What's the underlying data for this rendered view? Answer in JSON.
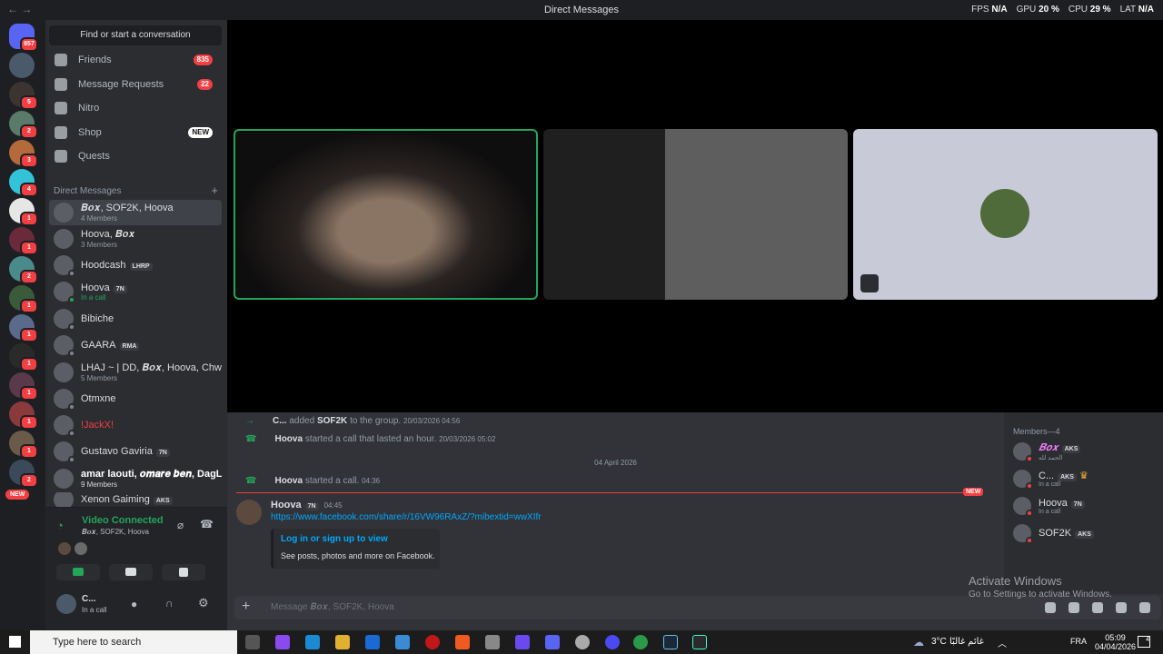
{
  "window": {
    "title": "Direct Messages",
    "nav": "←  →"
  },
  "overlay": {
    "fps_label": "FPS",
    "fps": "N/A",
    "gpu_label": "GPU",
    "gpu": "20 %",
    "cpu_label": "CPU",
    "cpu": "29 %",
    "lat_label": "LAT",
    "lat": "N/A"
  },
  "guilds": {
    "home_badge": "857",
    "new_label": "NEW",
    "badges": [
      "5",
      "2",
      "3",
      "4",
      "1",
      "1",
      "2",
      "1",
      "1",
      "1",
      "1",
      "1",
      "1",
      "2",
      "1"
    ]
  },
  "sidebar": {
    "find": "Find or start a conversation",
    "nav": [
      {
        "label": "Friends",
        "badge": "835"
      },
      {
        "label": "Message Requests",
        "badge": "22"
      },
      {
        "label": "Nitro",
        "badge": ""
      },
      {
        "label": "Shop",
        "badge": "NEW"
      },
      {
        "label": "Quests",
        "badge": ""
      }
    ],
    "dm_header": "Direct Messages",
    "dms": [
      {
        "name": "𝑩𝒐𝒙, SOF2K, Hoova",
        "sub": "4 Members",
        "tag": ""
      },
      {
        "name": "Hoova, 𝑩𝒐𝒙",
        "sub": "3 Members",
        "tag": ""
      },
      {
        "name": "Hoodcash",
        "sub": "",
        "tag": "LHRP"
      },
      {
        "name": "Hoova",
        "sub": "In a call",
        "tag": "7N"
      },
      {
        "name": "Bibiche",
        "sub": "",
        "tag": ""
      },
      {
        "name": "GAARA",
        "sub": "",
        "tag": "RMA"
      },
      {
        "name": "LHAJ ~ | DD, 𝑩𝒐𝒙, Hoova, Chwi...",
        "sub": "5 Members",
        "tag": ""
      },
      {
        "name": "Otmxne",
        "sub": "",
        "tag": ""
      },
      {
        "name": "!JackX!",
        "sub": "",
        "tag": ""
      },
      {
        "name": "Gustavo Gaviria",
        "sub": "",
        "tag": "7N"
      },
      {
        "name": "amar laouti, 𝒐𝒎𝒂𝒓𝒆 𝒃𝒆𝒏, DagLa,...",
        "sub": "9 Members",
        "tag": ""
      },
      {
        "name": "Xenon Gaiming",
        "sub": "",
        "tag": "AKS"
      }
    ]
  },
  "voice": {
    "status": "Video Connected",
    "channel": "𝑩𝒐𝒙, SOF2K, Hoova"
  },
  "user": {
    "name": "C...",
    "status": "In a call"
  },
  "chat": {
    "system": [
      {
        "actor": "C...",
        "text": "added",
        "target": "SOF2K",
        "rest": "to the group.",
        "time": "20/03/2026 04:56"
      },
      {
        "actor": "Hoova",
        "text": "started a call that lasted an hour.",
        "target": "",
        "rest": "",
        "time": "20/03/2026 05:02"
      }
    ],
    "date_divider": "04 April 2026",
    "call": {
      "actor": "Hoova",
      "text": "started a call.",
      "time": "04:36"
    },
    "new_label": "NEW",
    "message": {
      "author": "Hoova",
      "tag": "7N",
      "time": "04:45",
      "link": "https://www.facebook.com/share/r/16VW96RAxZ/?mibextid=wwXIfr",
      "embed_title": "Log in or sign up to view",
      "embed_desc": "See posts, photos and more on Facebook."
    }
  },
  "members": {
    "header": "Members—4",
    "list": [
      {
        "name": "𝑩𝒐𝒙",
        "sub": "الحمد لله",
        "tag": "AKS"
      },
      {
        "name": "C...",
        "sub": "In a call",
        "tag": "AKS"
      },
      {
        "name": "Hoova",
        "sub": "In a call",
        "tag": "7N"
      },
      {
        "name": "SOF2K",
        "sub": "",
        "tag": "AKS"
      }
    ]
  },
  "compose": {
    "placeholder": "Message 𝑩𝒐𝒙, SOF2K, Hoova"
  },
  "watermark": {
    "title": "Activate Windows",
    "sub": "Go to Settings to activate Windows."
  },
  "taskbar": {
    "search": "Type here to search",
    "weather": "3°C",
    "weather_text": "غائم غالبًا",
    "lang": "FRA",
    "time": "05:09",
    "date": "04/04/2026",
    "notif": "4"
  },
  "colors": {
    "accent": "#5865f2",
    "online": "#23a55a",
    "danger": "#f23f43",
    "link": "#00a8fc"
  }
}
